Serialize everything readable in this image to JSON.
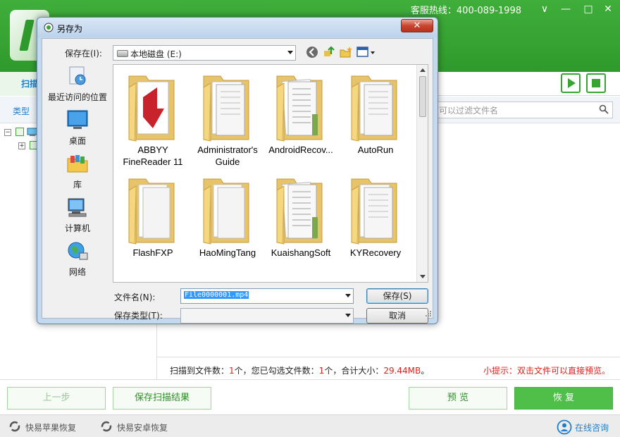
{
  "app": {
    "hotline": "客服热线：400-089-1998",
    "controls": {
      "menu": "∨",
      "minimize": "—",
      "maximize": "□",
      "close": "✕"
    },
    "tab_scan": "扫描",
    "filter": {
      "type_label": "类型",
      "placeholder": "可以过滤文件名"
    },
    "status": {
      "prefix": "扫描到文件数：",
      "found": "1",
      "mid1": "个，您已勾选文件数：",
      "selected": "1",
      "mid2": "个，合计大小：",
      "size": "29.44MB",
      "suffix": "。"
    },
    "tip": "小提示：双击文件可以直接预览。",
    "buttons": {
      "prev": "上一步",
      "save_results": "保存扫描结果",
      "preview": "预 览",
      "recover": "恢 复"
    },
    "footer": {
      "apple": "快易苹果恢复",
      "android": "快易安卓恢复",
      "consult": "在线咨询"
    },
    "colors": {
      "brand_green": "#36a531",
      "link_blue": "#1d7fd0",
      "highlight_red": "#e02020"
    }
  },
  "dialog": {
    "title": "另存为",
    "close": "✕",
    "save_in_label": "保存在(I):",
    "save_in_value": "本地磁盘 (E:)",
    "places": [
      {
        "label": "最近访问的位置",
        "icon": "recent-places-icon"
      },
      {
        "label": "桌面",
        "icon": "desktop-icon"
      },
      {
        "label": "库",
        "icon": "libraries-icon"
      },
      {
        "label": "计算机",
        "icon": "computer-icon"
      },
      {
        "label": "网络",
        "icon": "network-icon"
      }
    ],
    "files": [
      {
        "line1": "ABBYY",
        "line2": "FineReader 11",
        "variant": "abbyy"
      },
      {
        "line1": "Administrator's",
        "line2": "Guide",
        "variant": "docs"
      },
      {
        "line1": "AndroidRecov...",
        "line2": "",
        "variant": "papers"
      },
      {
        "line1": "AutoRun",
        "line2": "",
        "variant": "docs"
      },
      {
        "line1": "FlashFXP",
        "line2": "",
        "variant": "plain"
      },
      {
        "line1": "HaoMingTang",
        "line2": "",
        "variant": "plain"
      },
      {
        "line1": "KuaishangSoft",
        "line2": "",
        "variant": "papers"
      },
      {
        "line1": "KYRecovery",
        "line2": "",
        "variant": "docs"
      }
    ],
    "filename_label": "文件名(N):",
    "filename_value": "File0000001.mp4",
    "filetype_label": "保存类型(T):",
    "filetype_value": "",
    "save_button": "保存(S)",
    "cancel_button": "取消"
  }
}
